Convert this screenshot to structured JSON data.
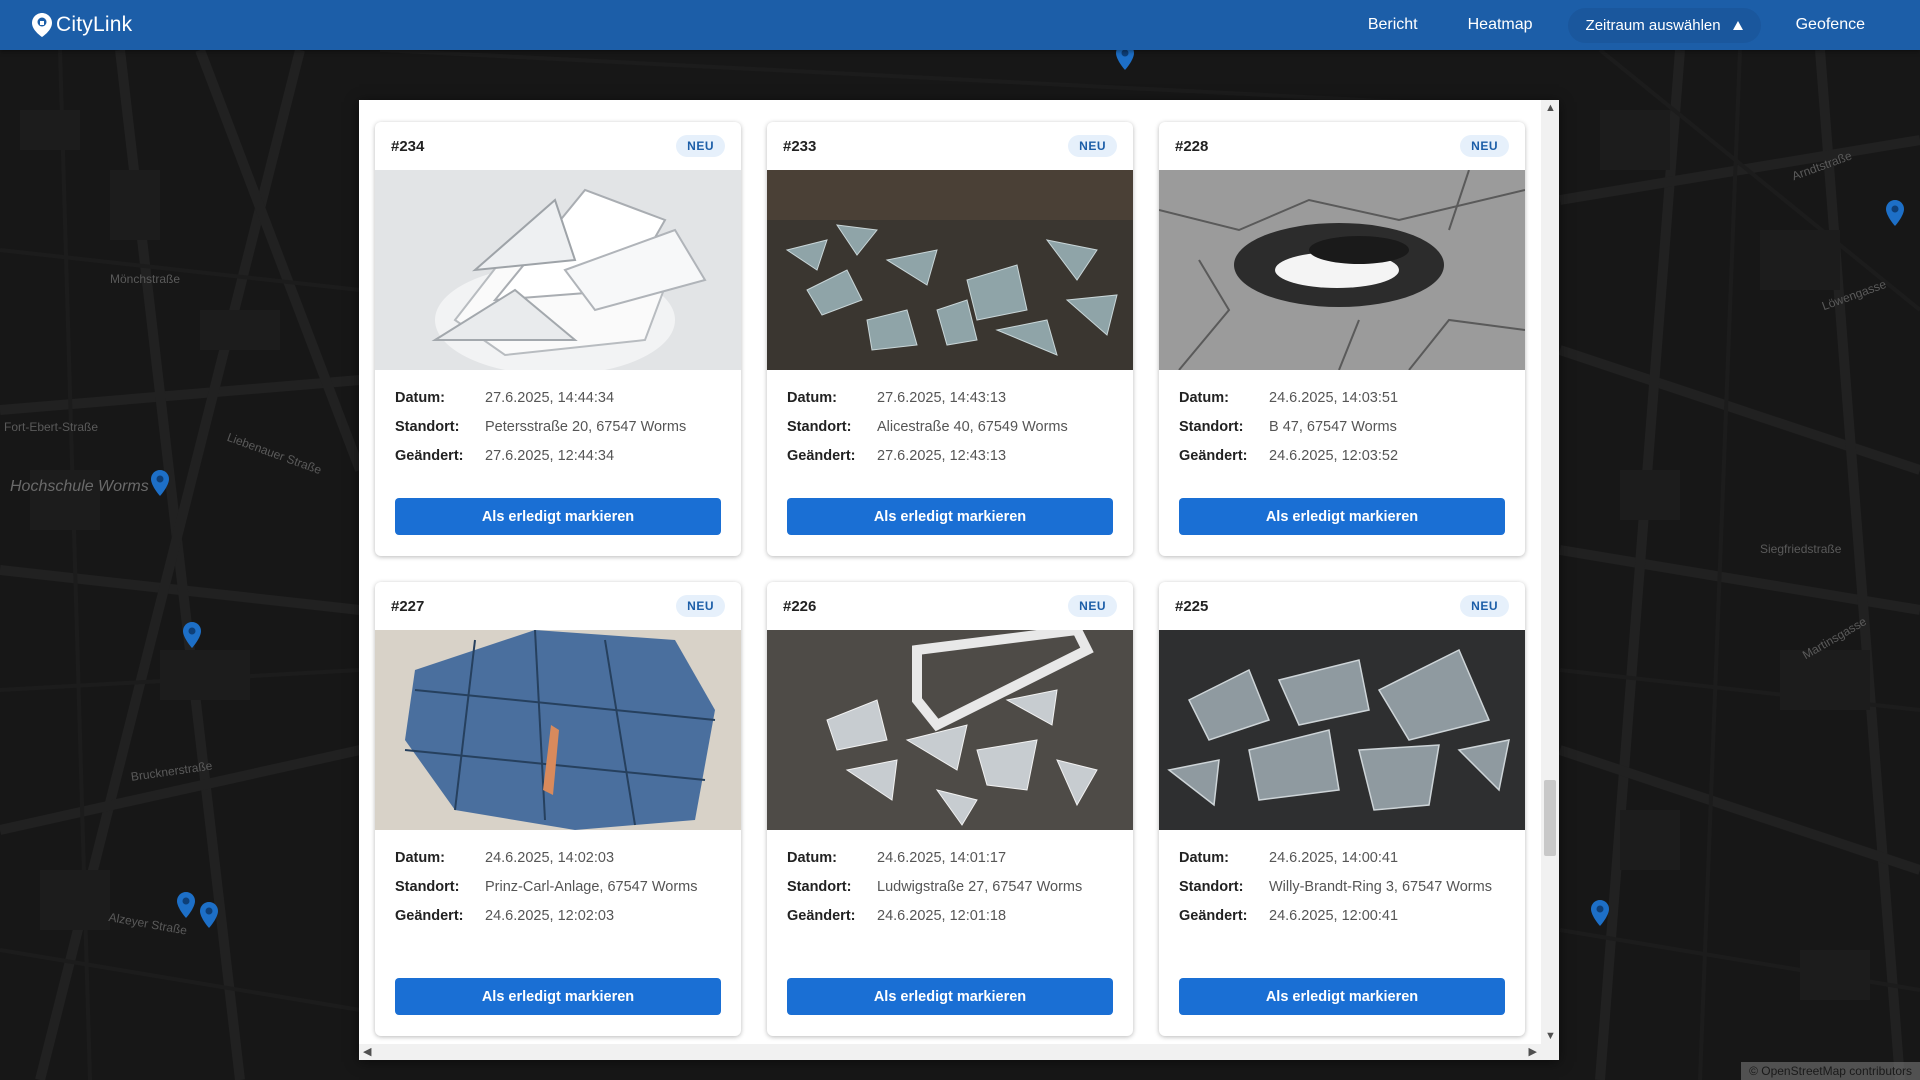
{
  "app": {
    "name": "CityLink",
    "logo_icon": "map-pin-icon"
  },
  "nav": {
    "report": "Bericht",
    "heatmap": "Heatmap",
    "period": "Zeitraum auswählen",
    "period_icon": "triangle-up-icon",
    "geofence": "Geofence"
  },
  "map": {
    "attribution": "© OpenStreetMap contributors",
    "labels": [
      "Hochschule Worms",
      "Fort-Ebert-Straße",
      "Liebenauer Straße",
      "Mönchstraße",
      "Alzeyer Straße",
      "Bruckner­straße",
      "Siegfriedstraße",
      "Löwengasse",
      "Arndtstraße",
      "Martinsgasse"
    ]
  },
  "labels": {
    "date": "Datum:",
    "location": "Standort:",
    "changed": "Geändert:",
    "action": "Als erledigt markieren"
  },
  "colors": {
    "primary": "#1a6fd4",
    "topbar": "#1c5ea8",
    "badge_bg": "#e6f0fb"
  },
  "reports": [
    {
      "id": "#234",
      "status": "NEU",
      "photo": "broken-plates",
      "date": "27.6.2025, 14:44:34",
      "location": "Petersstraße 20, 67547 Worms",
      "changed": "27.6.2025, 12:44:34"
    },
    {
      "id": "#233",
      "status": "NEU",
      "photo": "glass-shards-on-leaves",
      "date": "27.6.2025, 14:43:13",
      "location": "Alicestraße 40, 67549 Worms",
      "changed": "27.6.2025, 12:43:13"
    },
    {
      "id": "#228",
      "status": "NEU",
      "photo": "pothole",
      "date": "24.6.2025, 14:03:51",
      "location": "B 47, 67547 Worms",
      "changed": "24.6.2025, 12:03:52"
    },
    {
      "id": "#227",
      "status": "NEU",
      "photo": "broken-mirror",
      "date": "24.6.2025, 14:02:03",
      "location": "Prinz-Carl-Anlage, 67547 Worms",
      "changed": "24.6.2025, 12:02:03"
    },
    {
      "id": "#226",
      "status": "NEU",
      "photo": "broken-frame-glass",
      "date": "24.6.2025, 14:01:17",
      "location": "Ludwigstraße 27, 67547 Worms",
      "changed": "24.6.2025, 12:01:18"
    },
    {
      "id": "#225",
      "status": "NEU",
      "photo": "glass-on-asphalt",
      "date": "24.6.2025, 14:00:41",
      "location": "Willy-Brandt-Ring 3, 67547 Worms",
      "changed": "24.6.2025, 12:00:41"
    }
  ]
}
